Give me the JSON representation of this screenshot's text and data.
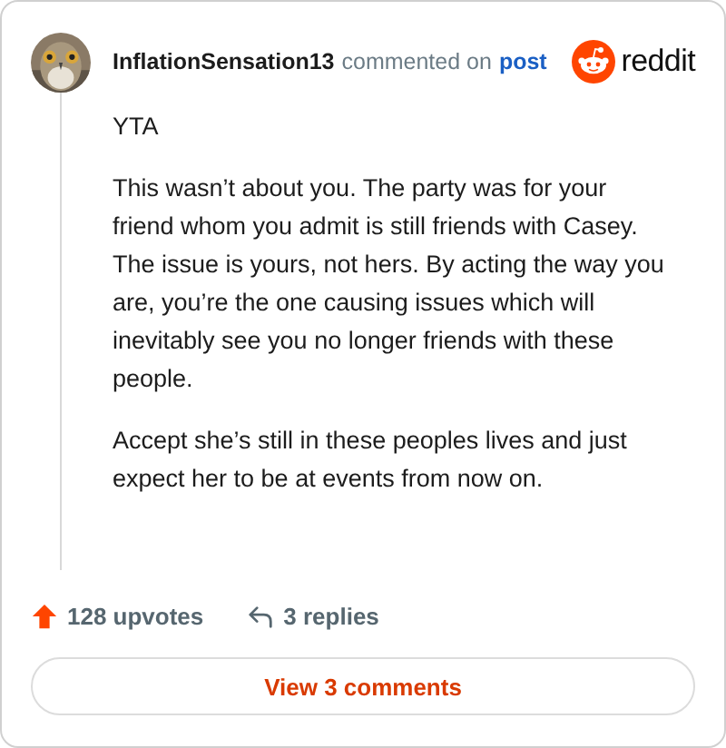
{
  "header": {
    "username": "InflationSensation13",
    "action": "commented on",
    "link": "post",
    "logo_text": "reddit"
  },
  "paragraphs": [
    "YTA",
    "This wasn’t about you. The party was for your friend whom you admit is still friends with Casey. The issue is yours, not hers. By acting the way you are, you’re the one causing issues which will inevitably see you no longer friends with these people.",
    "Accept she’s still in these peoples lives and just expect her to be at events from now on."
  ],
  "footer": {
    "upvotes": "128 upvotes",
    "replies": "3 replies"
  },
  "button": "View 3 comments"
}
